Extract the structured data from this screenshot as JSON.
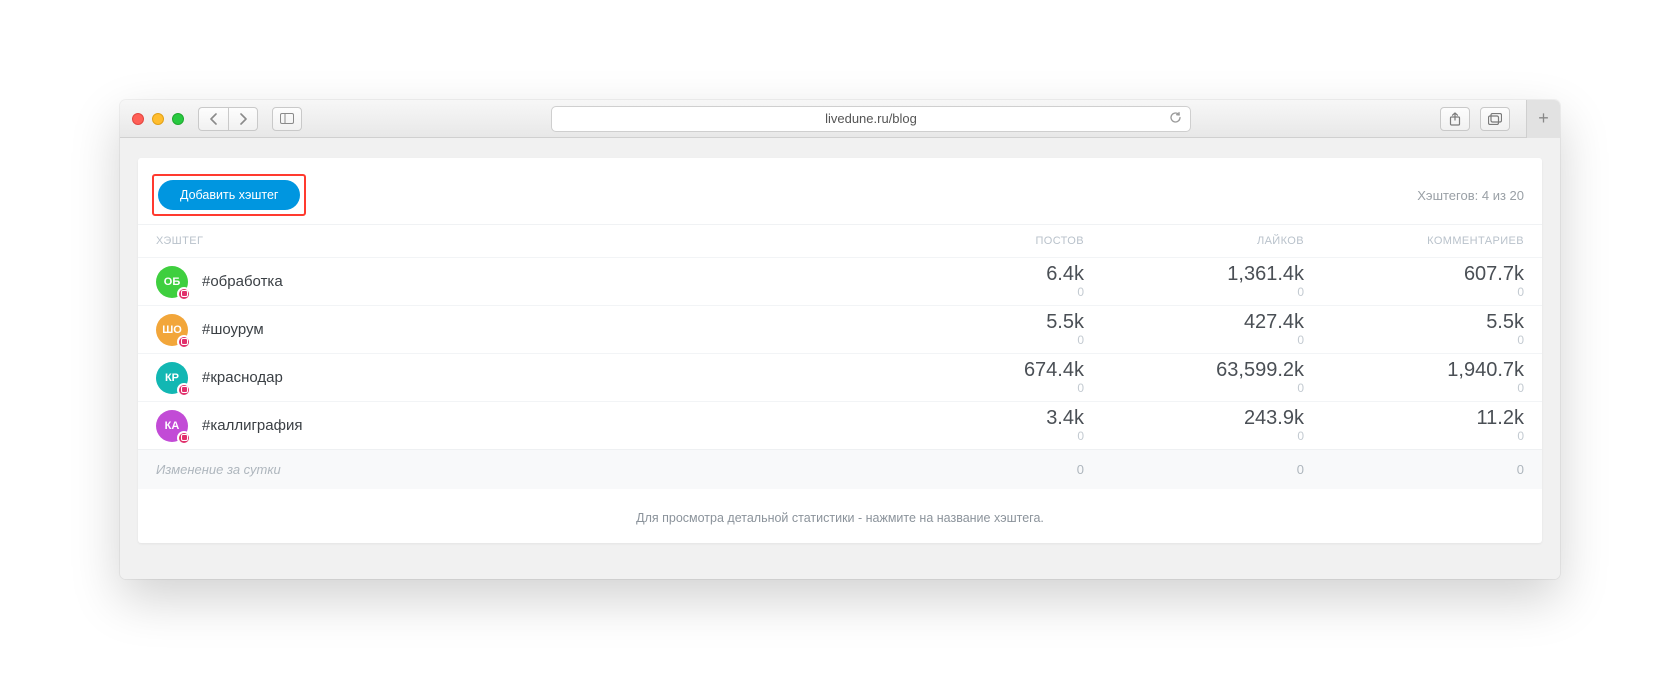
{
  "browser": {
    "url": "livedune.ru/blog"
  },
  "panel": {
    "add_button_label": "Добавить хэштег",
    "count_label": "Хэштегов: 4 из 20",
    "columns": {
      "hashtag": "ХЭШТЕГ",
      "posts": "ПОСТОВ",
      "likes": "ЛАЙКОВ",
      "comments": "КОММЕНТАРИЕВ"
    },
    "rows": [
      {
        "initials": "ОБ",
        "color": "#3fcf3f",
        "name": "#обработка",
        "posts": "6.4k",
        "posts_delta": "0",
        "likes": "1,361.4k",
        "likes_delta": "0",
        "comments": "607.7k",
        "comments_delta": "0"
      },
      {
        "initials": "ШО",
        "color": "#f2a63a",
        "name": "#шоурум",
        "posts": "5.5k",
        "posts_delta": "0",
        "likes": "427.4k",
        "likes_delta": "0",
        "comments": "5.5k",
        "comments_delta": "0"
      },
      {
        "initials": "КР",
        "color": "#12b7b3",
        "name": "#краснодар",
        "posts": "674.4k",
        "posts_delta": "0",
        "likes": "63,599.2k",
        "likes_delta": "0",
        "comments": "1,940.7k",
        "comments_delta": "0"
      },
      {
        "initials": "КА",
        "color": "#c24bd6",
        "name": "#каллиграфия",
        "posts": "3.4k",
        "posts_delta": "0",
        "likes": "243.9k",
        "likes_delta": "0",
        "comments": "11.2k",
        "comments_delta": "0"
      }
    ],
    "footer": {
      "label": "Изменение за сутки",
      "posts": "0",
      "likes": "0",
      "comments": "0"
    },
    "hint": "Для просмотра детальной статистики - нажмите на название хэштега."
  }
}
